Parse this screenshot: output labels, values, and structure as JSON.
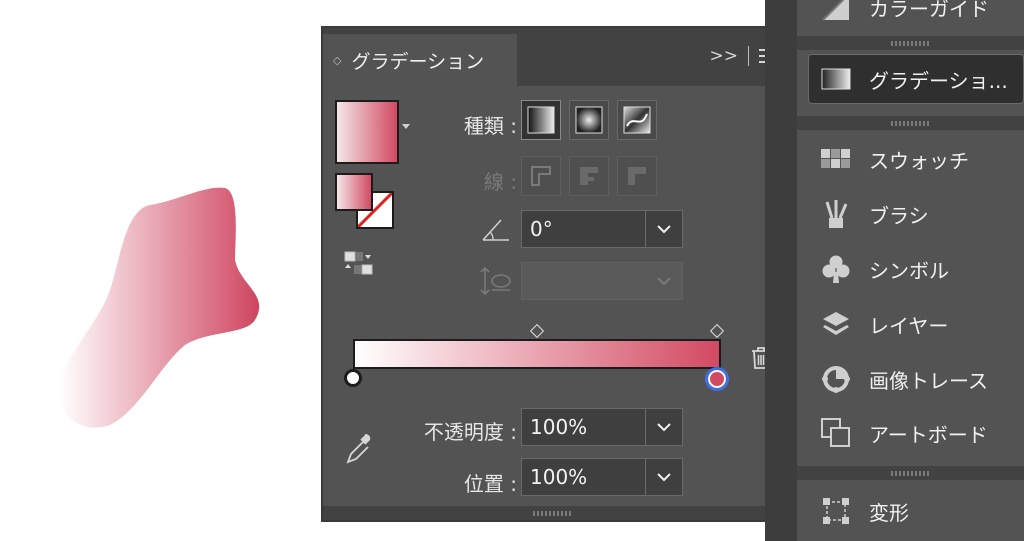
{
  "panel": {
    "tab_arrows": "◇",
    "title": "グラデーション",
    "collapse_label": ">>",
    "type_label": "種類 :",
    "stroke_label": "線 :",
    "angle_value": "0°",
    "aspect_value": "",
    "opacity_label": "不透明度 :",
    "opacity_value": "100%",
    "location_label": "位置 :",
    "location_value": "100%",
    "gradient_colors": {
      "start": "#ffffff",
      "end": "#d24a62"
    }
  },
  "dock": {
    "items": [
      {
        "label": "カラーガイド",
        "icon": "color-guide-icon"
      },
      {
        "label": "グラデーショ...",
        "icon": "gradient-icon"
      },
      {
        "label": "スウォッチ",
        "icon": "swatches-icon"
      },
      {
        "label": "ブラシ",
        "icon": "brushes-icon"
      },
      {
        "label": "シンボル",
        "icon": "symbols-icon"
      },
      {
        "label": "レイヤー",
        "icon": "layers-icon"
      },
      {
        "label": "画像トレース",
        "icon": "image-trace-icon"
      },
      {
        "label": "アートボード",
        "icon": "artboards-icon"
      },
      {
        "label": "変形",
        "icon": "transform-icon"
      }
    ]
  }
}
